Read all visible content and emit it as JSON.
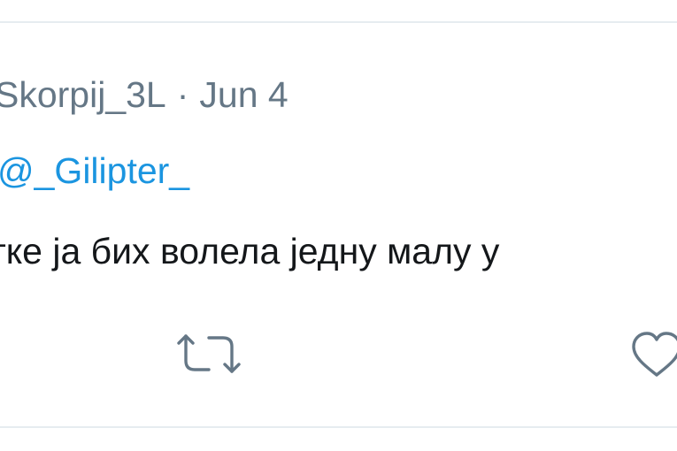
{
  "tweet": {
    "handle": "Skorpij_3L",
    "separator": "·",
    "date": "Jun 4",
    "reply_to": "@_Gilipter_",
    "text": "тке ја бих волела једну малу у"
  },
  "actions": [
    {
      "icon": "retweet-icon"
    },
    {
      "icon": "heart-icon"
    }
  ],
  "colors": {
    "text": "#14171a",
    "secondary": "#657786",
    "link": "#1b95e0",
    "icon": "#657786",
    "divider": "#e6ecf0"
  }
}
